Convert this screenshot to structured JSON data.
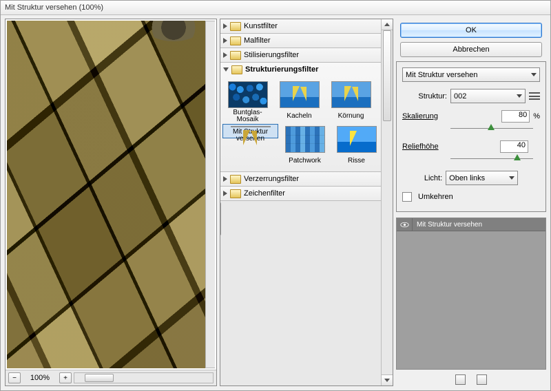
{
  "title": "Mit Struktur versehen (100%)",
  "preview": {
    "zoom": "100%"
  },
  "categories": {
    "kunst": "Kunstfilter",
    "mal": "Malfilter",
    "stil": "Stilisierungsfilter",
    "strukt": "Strukturierungsfilter",
    "verz": "Verzerrungsfilter",
    "zeich": "Zeichenfilter"
  },
  "thumbs": [
    {
      "label": "Buntglas-Mosaik"
    },
    {
      "label": "Kacheln"
    },
    {
      "label": "Körnung"
    },
    {
      "label": "Mit Struktur versehen"
    },
    {
      "label": "Patchwork"
    },
    {
      "label": "Risse"
    }
  ],
  "buttons": {
    "ok": "OK",
    "cancel": "Abbrechen"
  },
  "settings": {
    "filterName": "Mit Struktur versehen",
    "struktur_label": "Struktur:",
    "struktur_value": "002",
    "skalierung_label": "Skalierung",
    "skalierung_value": "80",
    "skalierung_unit": "%",
    "relief_label": "Reliefhöhe",
    "relief_value": "40",
    "licht_label": "Licht:",
    "licht_value": "Oben links",
    "umkehren_label": "Umkehren"
  },
  "layer": {
    "name": "Mit Struktur versehen"
  }
}
